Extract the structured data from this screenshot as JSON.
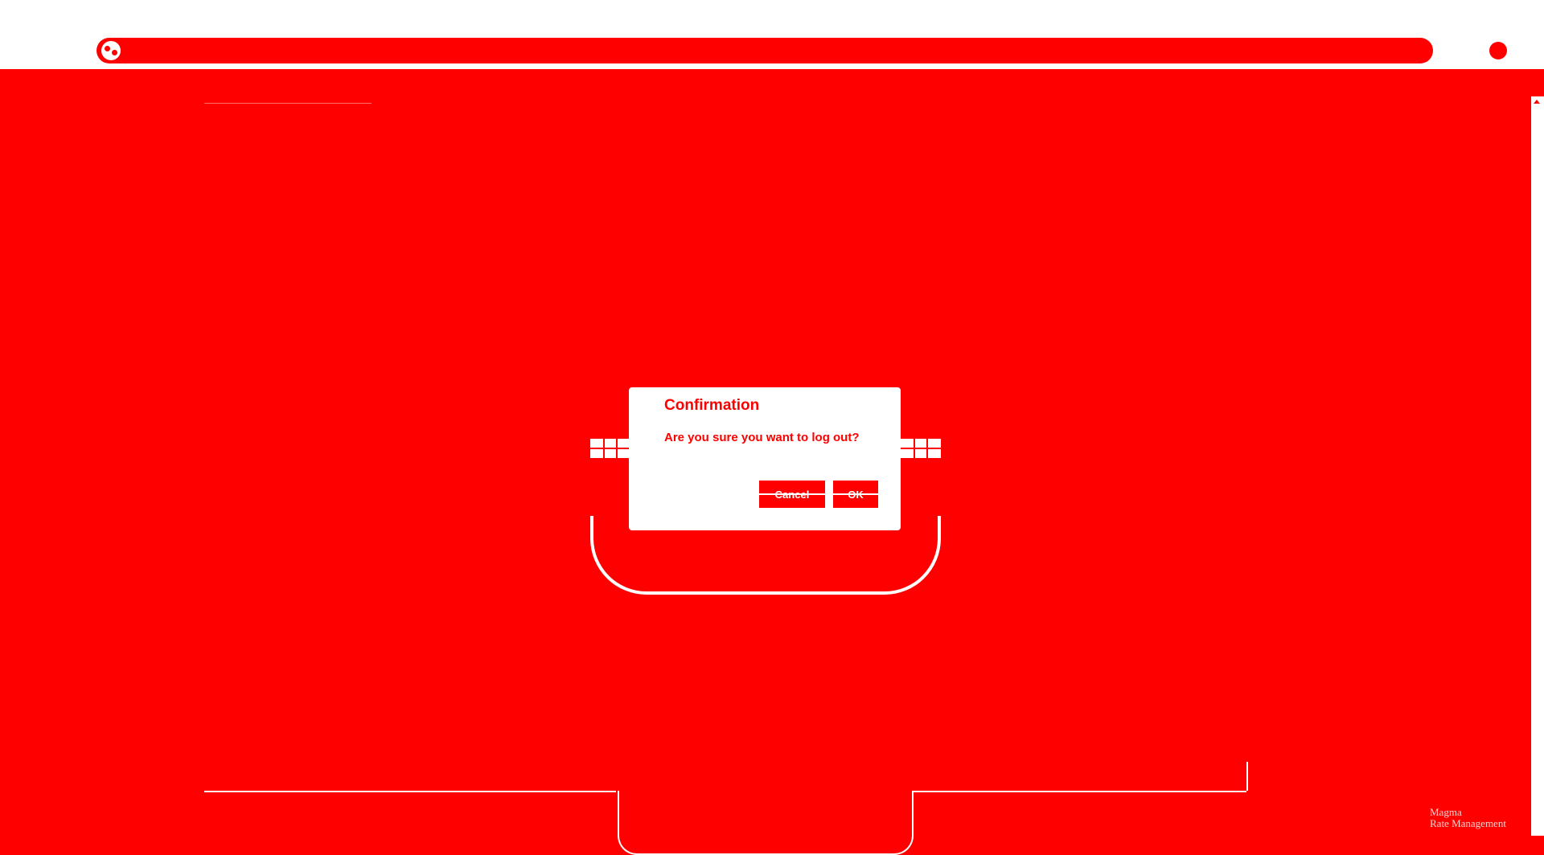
{
  "browser": {
    "address_text": "",
    "site_icon": "site-icon"
  },
  "dialog": {
    "title": "Confirmation",
    "message": "Are you sure you want to log out?",
    "cancel_label": "Cancel",
    "ok_label": "OK"
  },
  "footer": {
    "brand_line1": "Magma",
    "brand_line2": "Rate Management"
  },
  "colors": {
    "background": "#ff0000",
    "surface": "#ffffff"
  }
}
